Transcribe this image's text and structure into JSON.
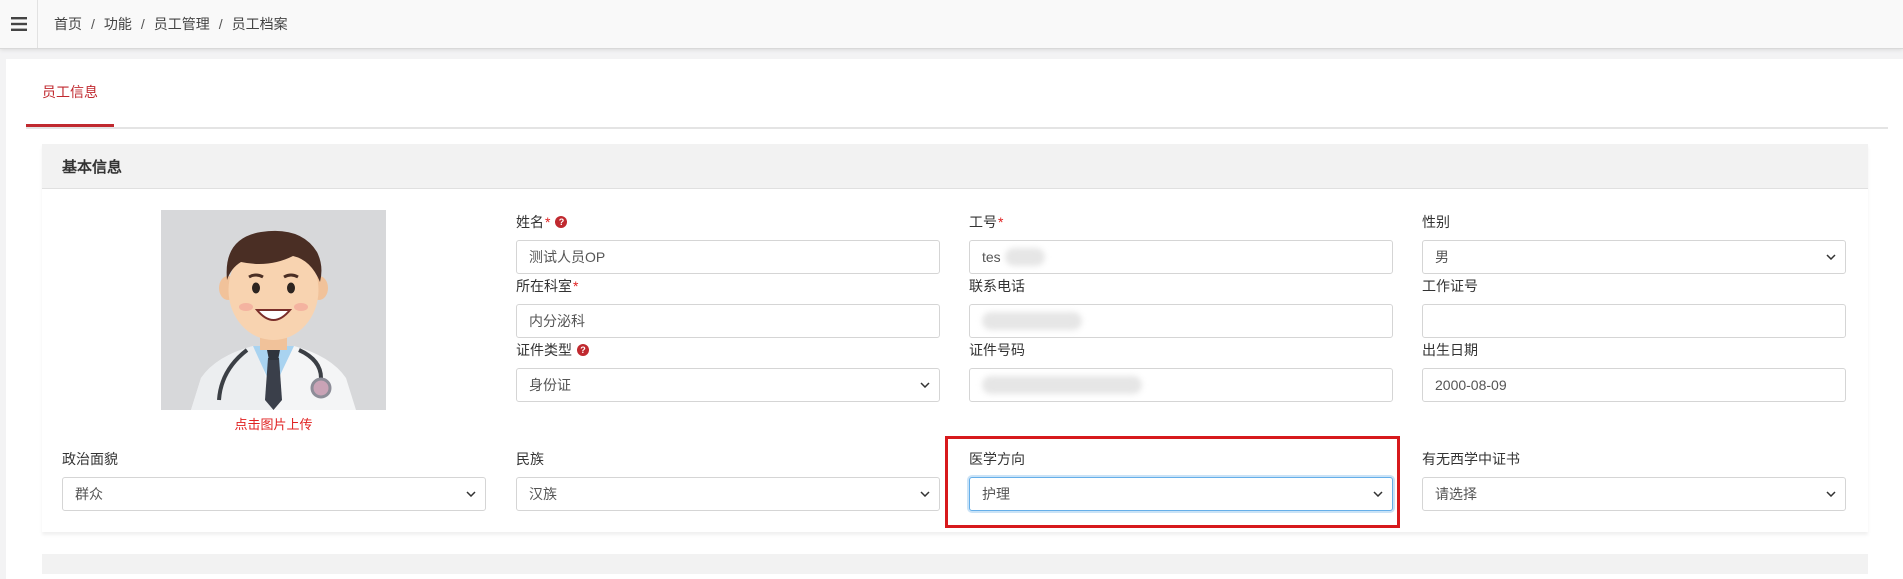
{
  "breadcrumb": {
    "menu_icon": "hamburger-menu-icon",
    "items": [
      "首页",
      "功能",
      "员工管理",
      "员工档案"
    ],
    "separator": "/"
  },
  "tabs": [
    {
      "label": "员工信息",
      "active": true
    }
  ],
  "basic_info": {
    "title": "基本信息",
    "photo": {
      "image": "doctor-avatar-illustration",
      "upload_hint": "点击图片上传"
    },
    "fields": {
      "name": {
        "label": "姓名",
        "required_mark": "*",
        "help_icon": "question-circle-icon",
        "value": "测试人员OP"
      },
      "employee_no": {
        "label": "工号",
        "required_mark": "*",
        "value": "tes"
      },
      "gender": {
        "label": "性别",
        "value": "男"
      },
      "department": {
        "label": "所在科室",
        "required_mark": "*",
        "value": "内分泌科"
      },
      "phone": {
        "label": "联系电话",
        "value": ""
      },
      "work_cert_no": {
        "label": "工作证号",
        "value": ""
      },
      "id_type": {
        "label": "证件类型",
        "help_icon": "question-circle-icon",
        "value": "身份证"
      },
      "id_number": {
        "label": "证件号码",
        "value": ""
      },
      "birth_date": {
        "label": "出生日期",
        "value": "2000-08-09"
      },
      "political_status": {
        "label": "政治面貌",
        "value": "群众"
      },
      "ethnicity": {
        "label": "民族",
        "value": "汉族"
      },
      "medical_direction": {
        "label": "医学方向",
        "value": "护理"
      },
      "tcm_western_cert": {
        "label": "有无西学中证书",
        "value": "请选择"
      }
    }
  },
  "colors": {
    "accent": "#c0292f",
    "required": "#e02020",
    "highlight": "#d7191c",
    "focus": "#66afe9"
  }
}
